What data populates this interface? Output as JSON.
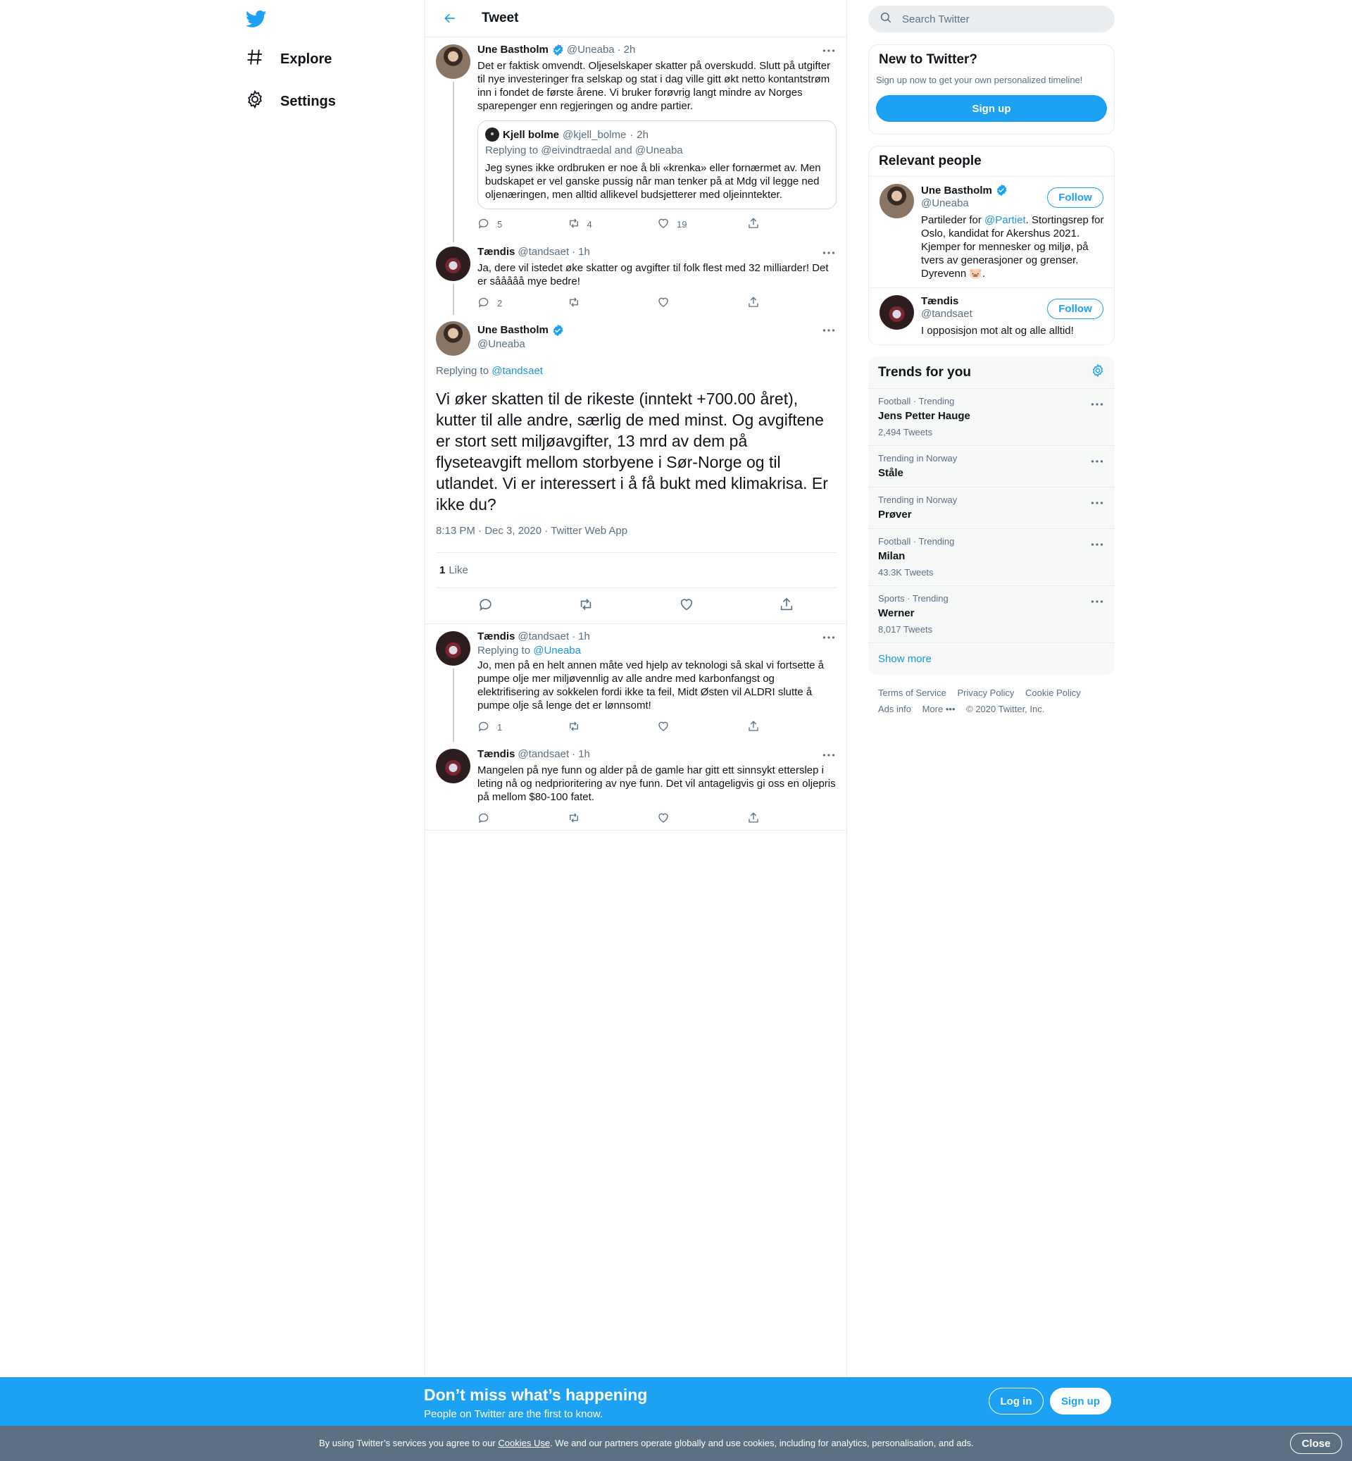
{
  "nav": {
    "logo": "twitter-bird-icon",
    "items": [
      {
        "label": "Explore",
        "icon": "hashtag-icon"
      },
      {
        "label": "Settings",
        "icon": "gear-icon"
      }
    ]
  },
  "header": {
    "title": "Tweet"
  },
  "thread": [
    {
      "name": "Une Bastholm",
      "handle": "@Uneaba",
      "time": "2h",
      "text": "Det er faktisk omvendt. Oljeselskaper skatter på overskudd. Slutt på utgifter til nye investeringer fra selskap og stat i dag ville gitt økt netto kontantstrøm inn i fondet de første årene. Vi bruker forøvrig langt mindre av Norges sparepenger enn regjeringen og andre partier.",
      "quote": {
        "name": "Kjell bolme",
        "handle": "@kjell_bolme",
        "time": "2h",
        "replying_prefix": "Replying to",
        "replying": "@eivindtraedal and @Uneaba",
        "text": "Jeg synes ikke ordbruken er noe å bli «krenka» eller fornærmet av. Men budskapet er vel ganske pussig når man tenker på at Mdg vil legge ned oljenæringen, men alltid allikevel budsjetterer med oljeinntekter."
      },
      "replies": "5",
      "retweets": "4",
      "likes": "19"
    },
    {
      "name": "Tændis",
      "handle": "@tandsaet",
      "time": "1h",
      "text": "Ja, dere vil istedet øke skatter og avgifter til folk flest med 32 milliarder! Det er sååååå mye bedre!",
      "replies": "2",
      "retweets": "",
      "likes": ""
    }
  ],
  "main": {
    "name": "Une Bastholm",
    "handle": "@Uneaba",
    "replying_prefix": "Replying to",
    "replying_to": "@tandsaet",
    "text": "Vi øker skatten til de rikeste (inntekt +700.00 året), kutter til alle andre, særlig de med minst. Og avgiftene er stort sett miljøavgifter, 13 mrd av dem på flyseteavgift mellom storbyene i Sør-Norge og til utlandet. Vi er interessert i å få bukt med klimakrisa. Er ikke du?",
    "timestamp": "8:13 PM · Dec 3, 2020 · Twitter Web App",
    "like_count": "1",
    "like_label": "Like"
  },
  "replies": [
    {
      "name": "Tændis",
      "handle": "@tandsaet",
      "time": "1h",
      "replying_prefix": "Replying to",
      "replying_to": "@Uneaba",
      "text": "Jo, men på en helt annen måte ved hjelp av teknologi så skal vi fortsette å pumpe olje mer miljøvennlig av alle andre med karbonfangst og elektrifisering av sokkelen fordi ikke ta feil, Midt Østen vil ALDRI slutte å pumpe olje så lenge det er lønnsomt!",
      "replies": "1"
    },
    {
      "name": "Tændis",
      "handle": "@tandsaet",
      "time": "1h",
      "text": "Mangelen på nye funn og alder på de gamle har gitt ett sinnsykt etterslep i leting nå og nedprioritering av nye funn. Det vil antageligvis gi oss en oljepris på mellom $80-100 fatet."
    }
  ],
  "search": {
    "placeholder": "Search Twitter"
  },
  "new_to_twitter": {
    "title": "New to Twitter?",
    "desc": "Sign up now to get your own personalized timeline!",
    "button": "Sign up"
  },
  "relevant": {
    "title": "Relevant people",
    "people": [
      {
        "name": "Une Bastholm",
        "handle": "@Uneaba",
        "follow": "Follow",
        "bio_pre": "Partileder for ",
        "bio_link": "@Partiet",
        "bio_post": ". Stortingsrep for Oslo, kandidat for Akershus 2021. Kjemper for mennesker og miljø, på tvers av generasjoner og grenser. Dyrevenn 🐷."
      },
      {
        "name": "Tændis",
        "handle": "@tandsaet",
        "follow": "Follow",
        "bio": "I opposisjon mot alt og alle alltid!"
      }
    ]
  },
  "trends": {
    "title": "Trends for you",
    "items": [
      {
        "context": "Football · Trending",
        "name": "Jens Petter Hauge",
        "count": "2,494 Tweets"
      },
      {
        "context": "Trending in Norway",
        "name": "Ståle",
        "count": ""
      },
      {
        "context": "Trending in Norway",
        "name": "Prøver",
        "count": ""
      },
      {
        "context": "Football · Trending",
        "name": "Milan",
        "count": "43.3K Tweets"
      },
      {
        "context": "Sports · Trending",
        "name": "Werner",
        "count": "8,017 Tweets"
      }
    ],
    "show_more": "Show more"
  },
  "footer": {
    "links": [
      "Terms of Service",
      "Privacy Policy",
      "Cookie Policy",
      "Ads info",
      "More •••",
      "© 2020 Twitter, Inc."
    ]
  },
  "banner": {
    "title": "Don’t miss what’s happening",
    "subtitle": "People on Twitter are the first to know.",
    "login": "Log in",
    "signup": "Sign up"
  },
  "cookie": {
    "pre": "By using Twitter’s services you agree to our ",
    "link": "Cookies Use",
    "post": ". We and our partners operate globally and use cookies, including for analytics, personalisation, and ads.",
    "close": "Close"
  },
  "colors": {
    "accent": "#1da1f2",
    "link": "#1b95e0",
    "secondary_text": "#5b7083",
    "cookie_bar": "#5b7083"
  }
}
